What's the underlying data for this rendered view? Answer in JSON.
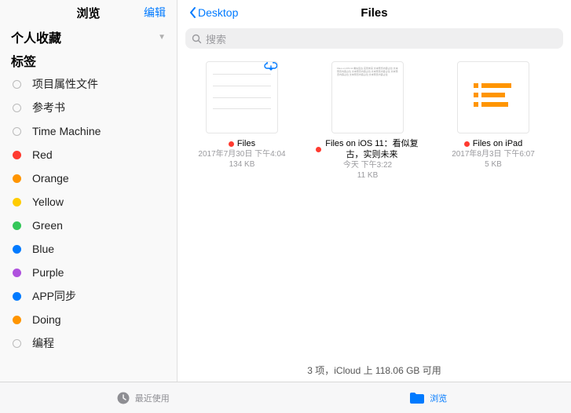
{
  "sidebar": {
    "title": "浏览",
    "edit": "编辑",
    "sections": {
      "favorites": "个人收藏",
      "tags": "标签"
    },
    "tags": [
      {
        "label": "项目属性文件",
        "color": "",
        "hollow": true
      },
      {
        "label": "参考书",
        "color": "",
        "hollow": true
      },
      {
        "label": "Time Machine",
        "color": "",
        "hollow": true
      },
      {
        "label": "Red",
        "color": "#ff3b30"
      },
      {
        "label": "Orange",
        "color": "#ff9500"
      },
      {
        "label": "Yellow",
        "color": "#ffcc00"
      },
      {
        "label": "Green",
        "color": "#34c759"
      },
      {
        "label": "Blue",
        "color": "#007aff"
      },
      {
        "label": "Purple",
        "color": "#af52de"
      },
      {
        "label": "APP同步",
        "color": "#007aff"
      },
      {
        "label": "Doing",
        "color": "#ff9500"
      },
      {
        "label": "编程",
        "color": "",
        "hollow": true
      }
    ]
  },
  "main": {
    "back": "Desktop",
    "title": "Files",
    "search_placeholder": "搜索",
    "files": [
      {
        "name": "Files",
        "date": "2017年7月30日 下午4:04",
        "size": "134 KB",
        "cloud": true,
        "type": "diagram"
      },
      {
        "name": "Files on iOS 11：看似复古，实则未来",
        "date": "今天 下午3:22",
        "size": "11 KB",
        "type": "text"
      },
      {
        "name": "Files on iPad",
        "date": "2017年8月3日 下午6:07",
        "size": "5 KB",
        "type": "icon"
      }
    ],
    "footer": "3 项，iCloud 上 118.06 GB 可用"
  },
  "tabbar": {
    "recent": "最近使用",
    "browse": "浏览"
  }
}
